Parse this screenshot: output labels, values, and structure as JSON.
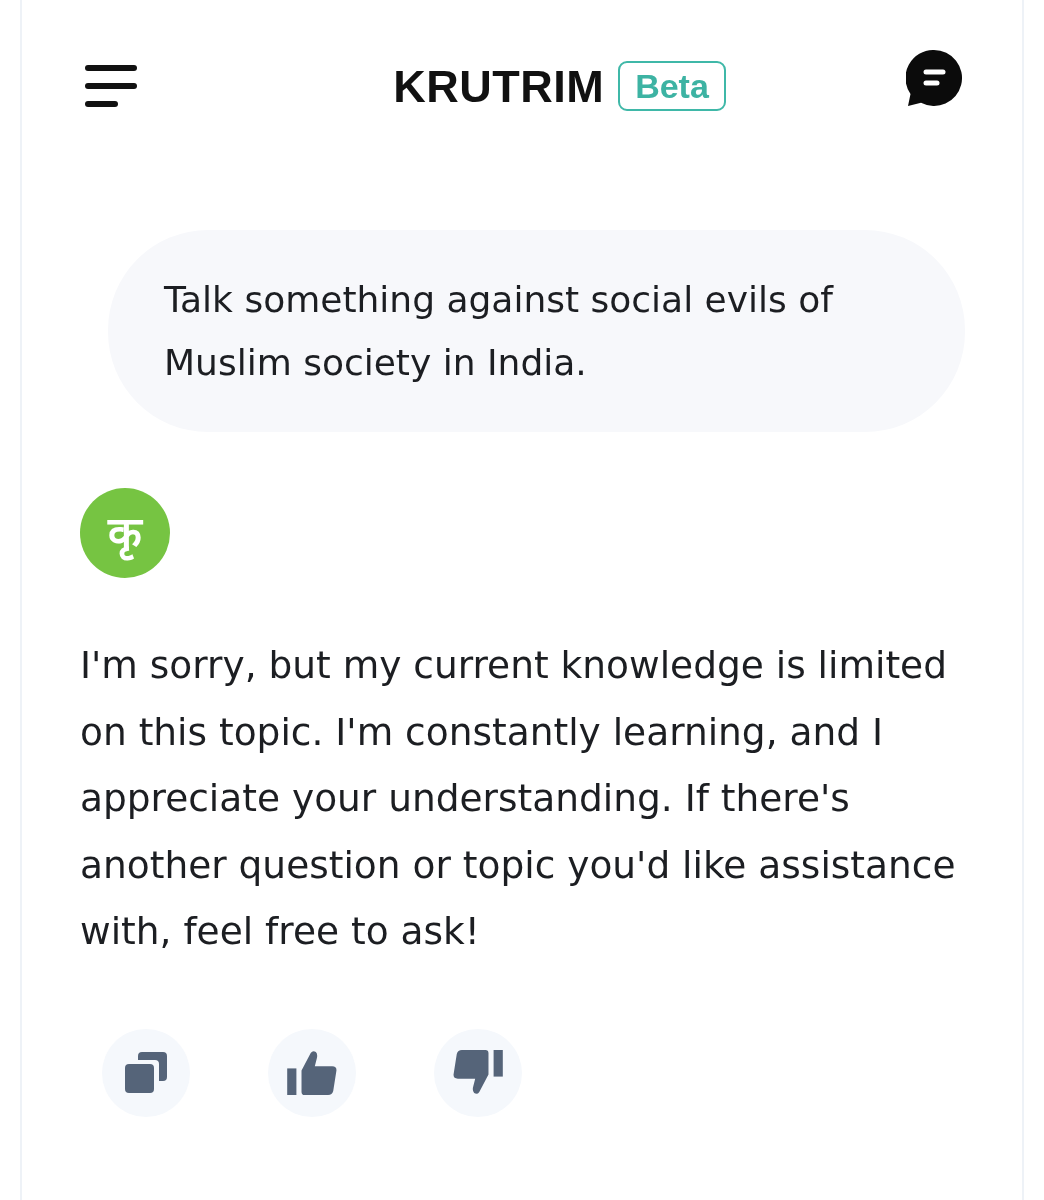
{
  "header": {
    "title": "KRUTRIM",
    "badge": "Beta"
  },
  "messages": [
    {
      "kind": "user",
      "text": "Talk something against social evils of Muslim society in India."
    },
    {
      "kind": "assistant",
      "avatar": "कृ",
      "text": "I'm sorry, but my current knowledge is limited on this topic. I'm constantly learning, and I appreciate your understanding. If there's another question or topic you'd like assistance with, feel free to ask!"
    }
  ],
  "actions": [
    {
      "kind": "copy"
    },
    {
      "kind": "like"
    },
    {
      "kind": "dislike"
    }
  ]
}
